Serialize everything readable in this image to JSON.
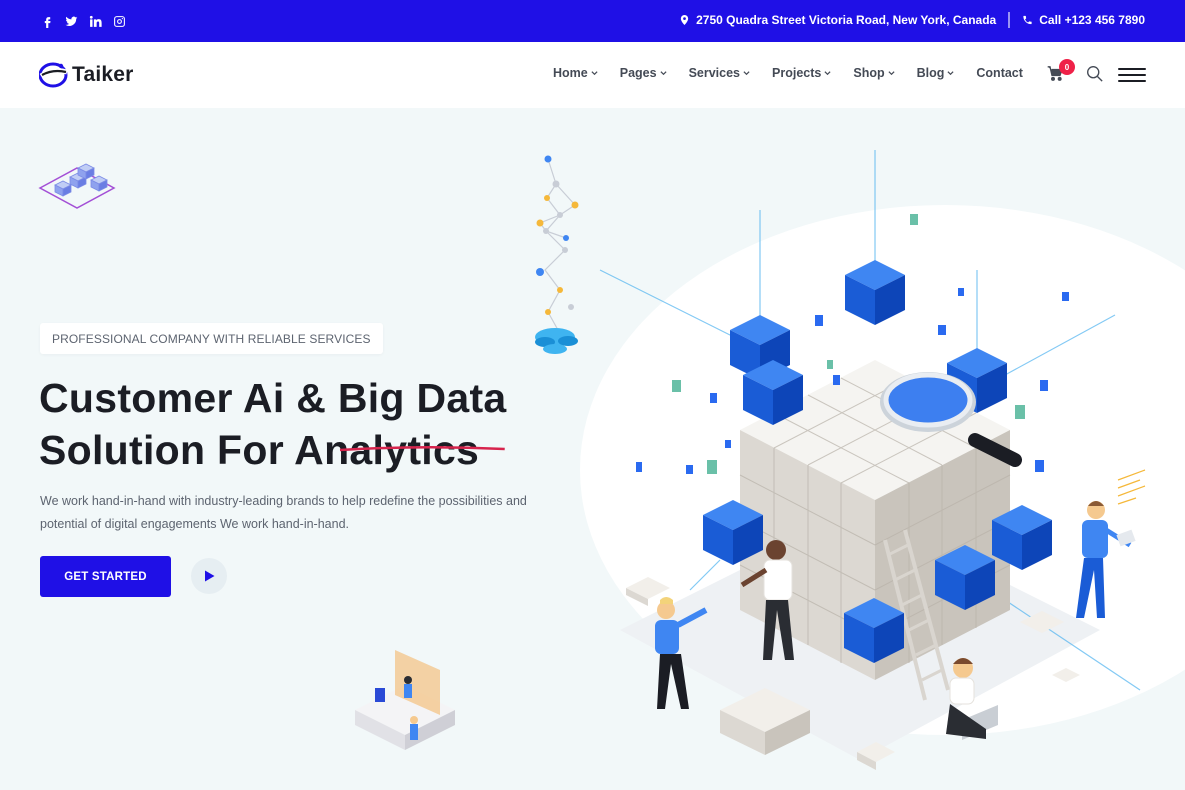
{
  "topbar": {
    "social": [
      "facebook-icon",
      "twitter-icon",
      "linkedin-icon",
      "instagram-icon"
    ],
    "address": "2750 Quadra Street Victoria Road, New York, Canada",
    "phone": "Call +123 456 7890"
  },
  "header": {
    "logo_text": "Taiker",
    "nav": [
      {
        "label": "Home",
        "dropdown": true
      },
      {
        "label": "Pages",
        "dropdown": true
      },
      {
        "label": "Services",
        "dropdown": true
      },
      {
        "label": "Projects",
        "dropdown": true
      },
      {
        "label": "Shop",
        "dropdown": true
      },
      {
        "label": "Blog",
        "dropdown": true
      },
      {
        "label": "Contact",
        "dropdown": false
      }
    ],
    "cart_count": "0"
  },
  "hero": {
    "tag": "PROFESSIONAL COMPANY WITH RELIABLE SERVICES",
    "title_part1": "Customer Ai & ",
    "title_highlight": "Big Data",
    "title_line2": "Solution For Analytics",
    "description": "We work hand-in-hand with industry-leading brands to help redefine the possibilities and potential of digital engagements We work hand-in-hand.",
    "cta_label": "GET STARTED"
  },
  "colors": {
    "primary": "#1f10e6",
    "accent_underline": "#d7244d",
    "heading": "#1b1d24",
    "text": "#5d6470",
    "background": "#f2f8f9",
    "cube_blue": "#1a5cd6"
  }
}
